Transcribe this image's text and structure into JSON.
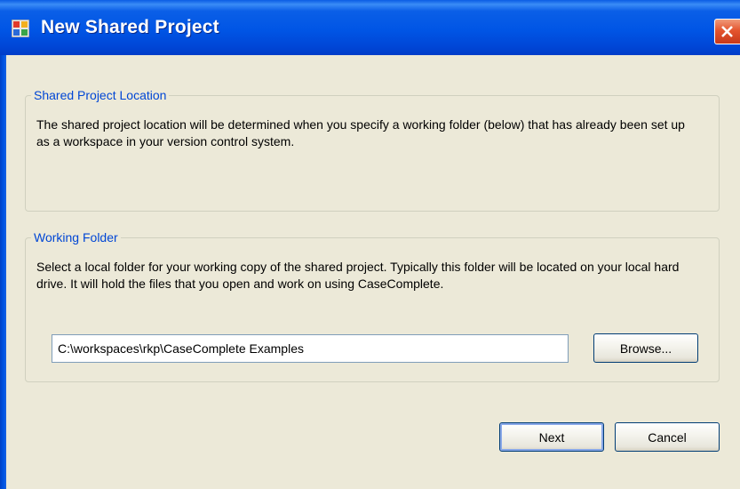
{
  "window": {
    "title": "New Shared Project",
    "icons": {
      "app": "app-icon",
      "close": "close-icon"
    },
    "colors": {
      "titlebar": "#0055e5",
      "background": "#ece9d8",
      "group_caption": "#0046d5",
      "close": "#e4552e"
    }
  },
  "location_group": {
    "caption": "Shared Project Location",
    "description": "The shared project location will be determined when you specify a working folder (below) that has already been set up as a workspace in your version control system."
  },
  "working_group": {
    "caption": "Working Folder",
    "description": "Select a local folder for your working copy of the shared project. Typically this folder will be located on your local hard drive. It will hold the files that you open and work on using CaseComplete.",
    "folder_value": "C:\\workspaces\\rkp\\CaseComplete Examples",
    "browse_label": "Browse..."
  },
  "footer": {
    "next_label": "Next",
    "cancel_label": "Cancel"
  }
}
